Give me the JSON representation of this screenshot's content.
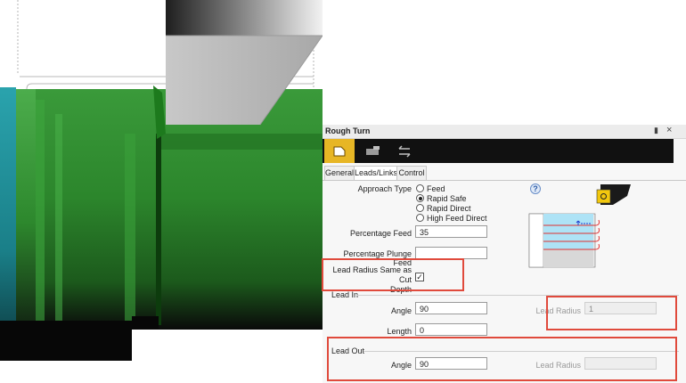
{
  "panel": {
    "title": "Rough Turn",
    "pin_icon": "pin-icon",
    "close_label": "×",
    "toolbar": [
      "tool-icon",
      "stock-icon",
      "links-icon"
    ],
    "tabs": [
      "General",
      "Leads/Links",
      "Control"
    ],
    "selected_tab": "Leads/Links",
    "help_label": "?",
    "approach_type": {
      "label": "Approach Type",
      "options": [
        "Feed",
        "Rapid Safe",
        "Rapid Direct",
        "High Feed Direct"
      ],
      "selected": "Rapid Safe"
    },
    "percentage_feed": {
      "label": "Percentage Feed",
      "value": "35"
    },
    "percentage_plunge_feed": {
      "label": "Percentage Plunge Feed",
      "value": ""
    },
    "lead_radius_same": {
      "label_line1": "Lead Radius Same as Cut",
      "label_line2": "Depth",
      "checked": true
    },
    "lead_in": {
      "header": "Lead In",
      "angle_label": "Angle",
      "angle_value": "90",
      "length_label": "Length",
      "length_value": "0",
      "radius_label": "Lead Radius",
      "radius_value": "1"
    },
    "lead_out": {
      "header": "Lead Out",
      "angle_label": "Angle",
      "angle_value": "90",
      "radius_label": "Lead Radius",
      "radius_value": ""
    }
  },
  "colors": {
    "highlight_box": "#e04a3c",
    "part_green": "#2f8f2f",
    "toolbar_bg": "#111111",
    "toolbar_active": "#e7b625"
  }
}
